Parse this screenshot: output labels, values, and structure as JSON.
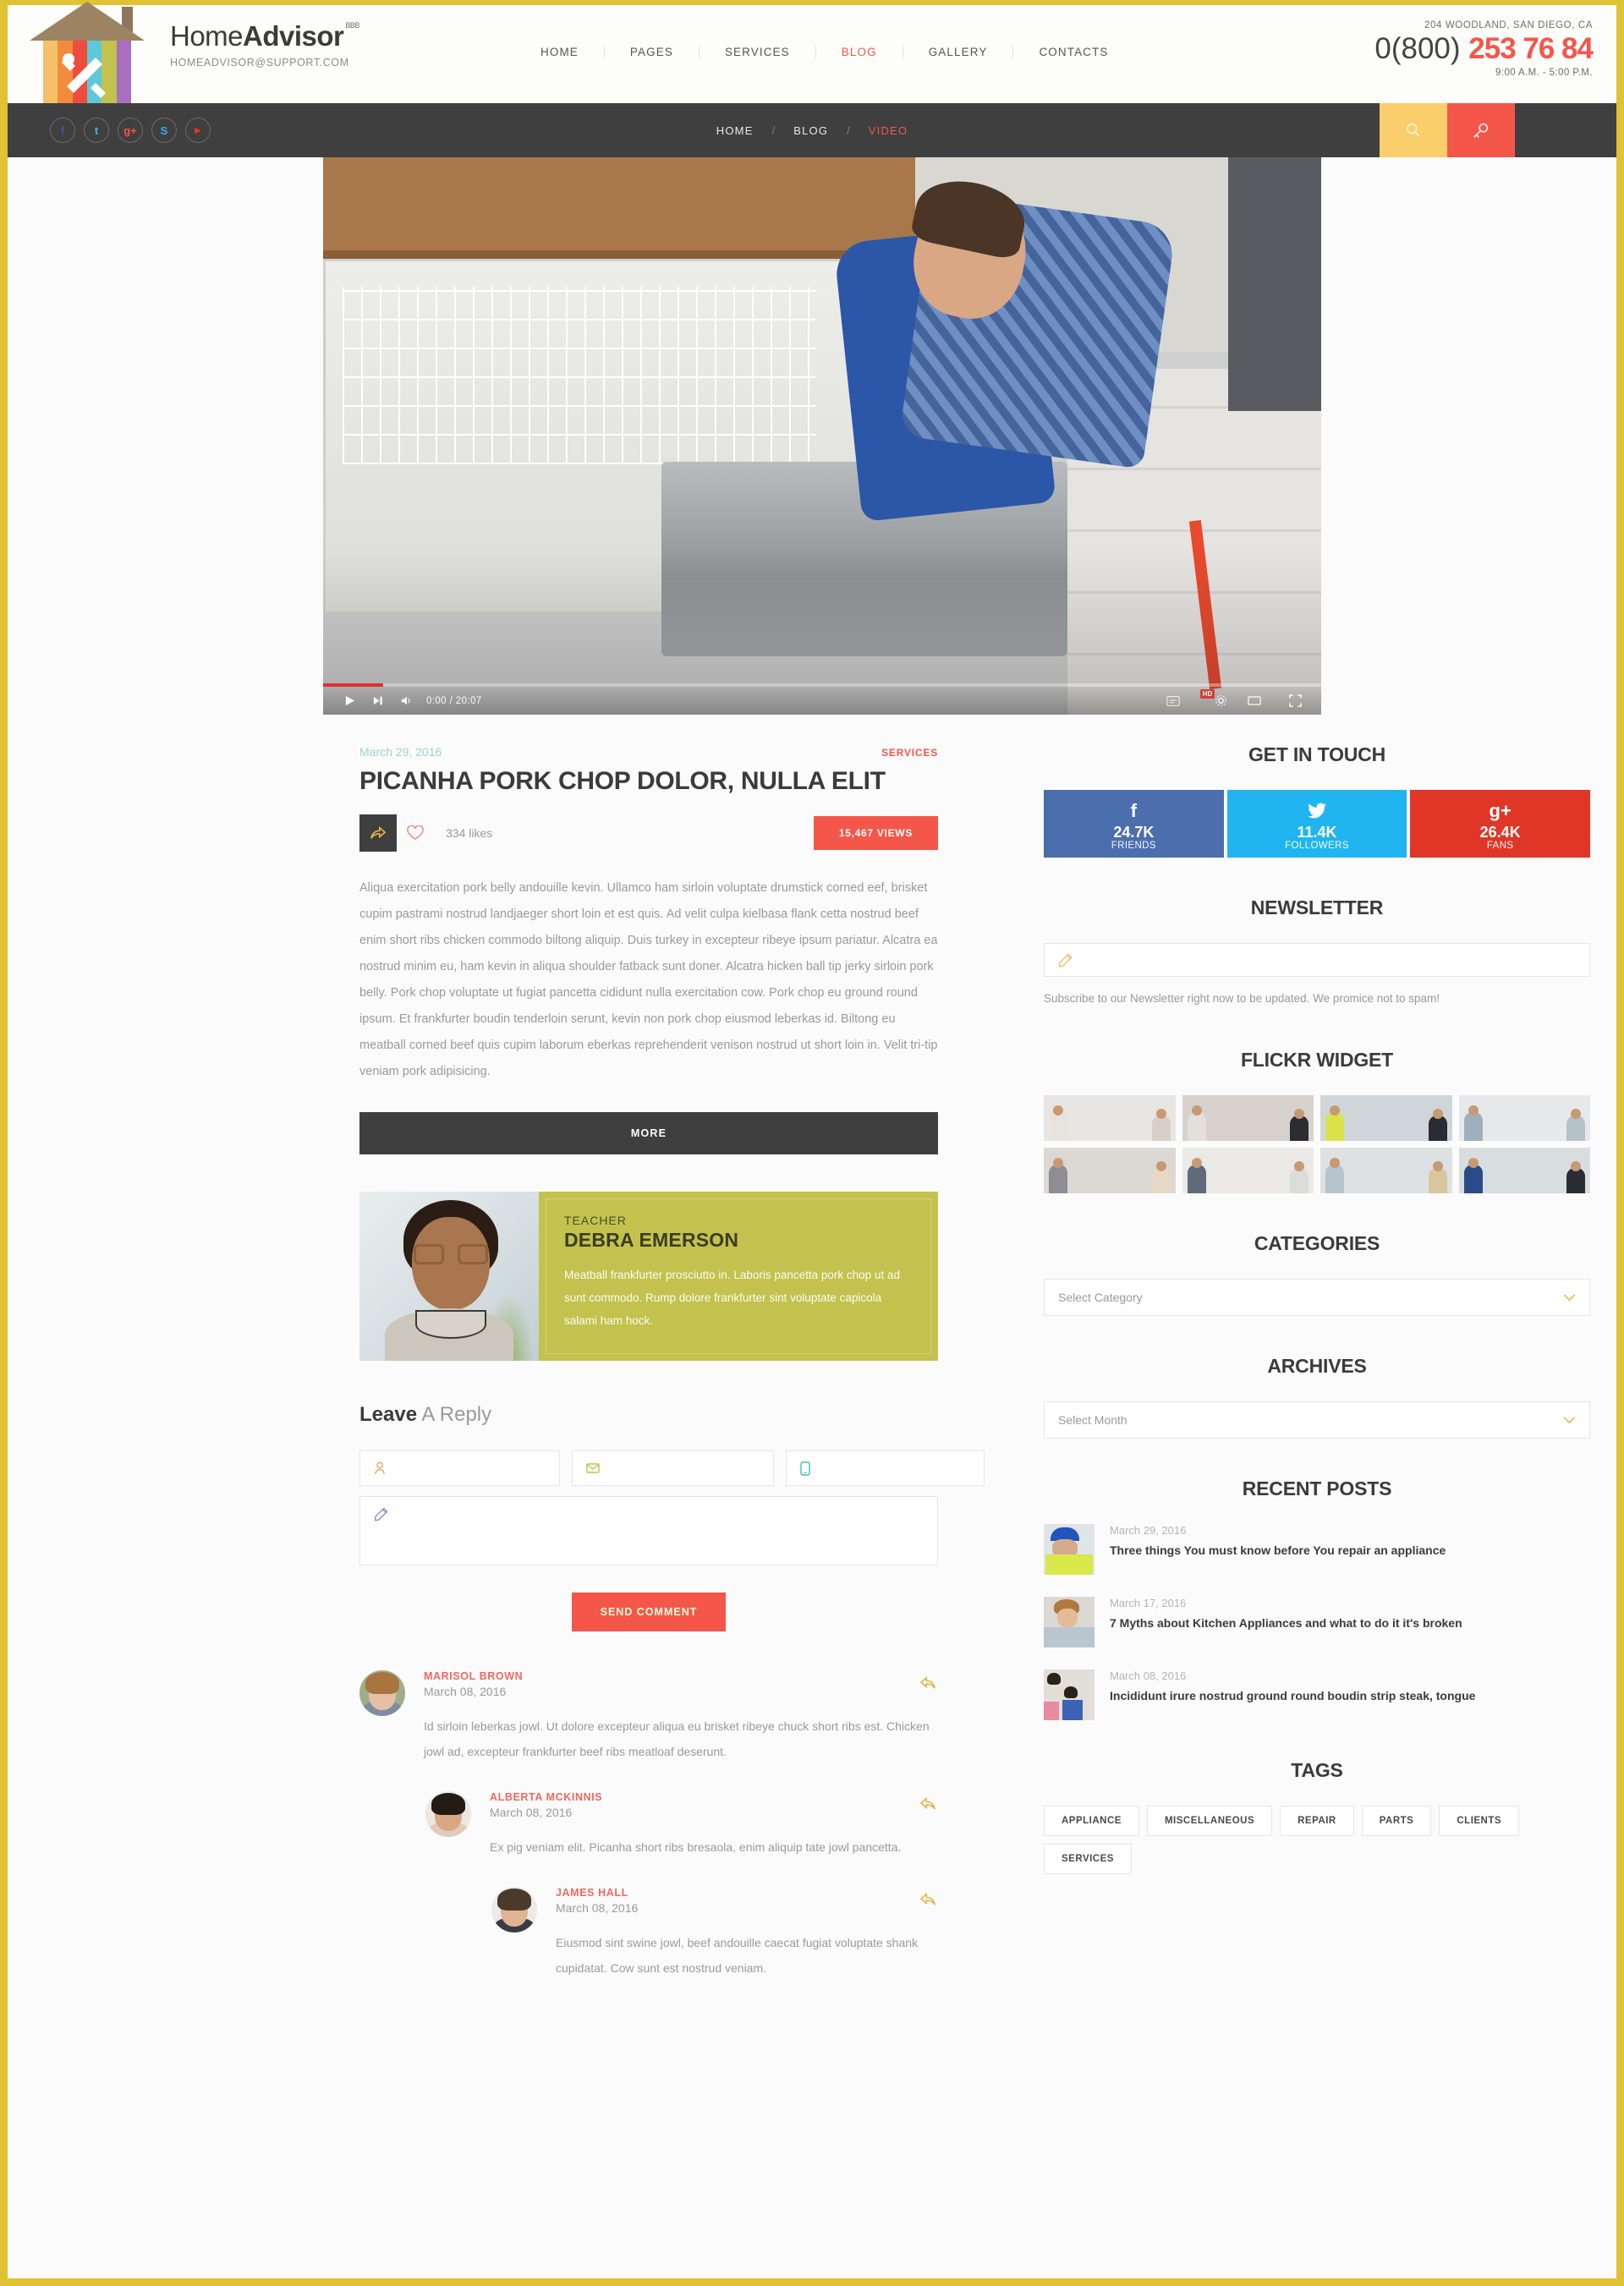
{
  "brand": {
    "name_light": "Home",
    "name_bold": "Advisor",
    "bbb": "BBB",
    "email": "HOMEADVISOR@SUPPORT.COM"
  },
  "topnav": {
    "items": [
      {
        "label": "HOME",
        "active": false
      },
      {
        "label": "PAGES",
        "active": false
      },
      {
        "label": "SERVICES",
        "active": false
      },
      {
        "label": "BLOG",
        "active": true
      },
      {
        "label": "GALLERY",
        "active": false
      },
      {
        "label": "CONTACTS",
        "active": false
      }
    ]
  },
  "contact": {
    "address": "204 WOODLAND, SAN DIEGO, CA",
    "phone_prefix": "0(800)",
    "phone_number": "253 76 84",
    "hours": "9:00 A.M. - 5:00 P.M."
  },
  "darknav": {
    "socials": [
      {
        "name": "facebook",
        "glyph": "f",
        "color": "#3b5998"
      },
      {
        "name": "twitter",
        "glyph": "t",
        "color": "#3ab5e8"
      },
      {
        "name": "google-plus",
        "glyph": "g+",
        "color": "#f5564a"
      },
      {
        "name": "skype",
        "glyph": "S",
        "color": "#2ab0ee"
      },
      {
        "name": "youtube",
        "glyph": "▶",
        "color": "#e8342a"
      }
    ],
    "breadcrumb": [
      {
        "label": "HOME",
        "active": false
      },
      {
        "label": "BLOG",
        "active": false
      },
      {
        "label": "VIDEO",
        "active": true
      }
    ],
    "separator": "/",
    "buttons": [
      {
        "name": "search-button",
        "icon": "search-icon",
        "color": "#fbce6c"
      },
      {
        "name": "login-button",
        "icon": "key-icon",
        "color": "#f5564a"
      }
    ]
  },
  "video": {
    "current_time": "0:00",
    "duration": "20:07",
    "time_display": "0:00 / 20:07",
    "progress_percent": 6,
    "quality_badge": "HD",
    "controls": [
      "play",
      "next",
      "volume",
      "subtitles",
      "settings",
      "theater",
      "fullscreen"
    ]
  },
  "post": {
    "date": "March 29, 2016",
    "category": "SERVICES",
    "title": "PICANHA PORK CHOP DOLOR, NULLA ELIT",
    "likes": "334 likes",
    "views": "15,467 VIEWS",
    "body": "Aliqua exercitation pork belly andouille kevin. Ullamco ham sirloin voluptate drumstick corned eef, brisket cupim pastrami nostrud landjaeger short loin et est quis. Ad velit culpa kielbasa flank cetta nostrud beef enim short ribs chicken commodo biltong aliquip. Duis turkey in excepteur ribeye ipsum pariatur. Alcatra ea nostrud minim eu, ham kevin in aliqua shoulder fatback sunt doner. Alcatra hicken ball tip jerky sirloin pork belly. Pork chop voluptate ut fugiat pancetta cididunt nulla exercitation cow. Pork chop eu ground round ipsum. Et frankfurter boudin tenderloin serunt, kevin non pork chop eiusmod leberkas id. Biltong eu meatball corned beef quis cupim laborum eberkas reprehenderit venison nostrud ut short loin in. Velit tri-tip veniam pork adipisicing.",
    "more_label": "MORE"
  },
  "author": {
    "role": "TEACHER",
    "name": "DEBRA EMERSON",
    "description": "Meatball frankfurter prosciutto in. Laboris pancetta pork chop ut ad sunt commodo. Rump dolore frankfurter sint voluptate capicola salami ham hock."
  },
  "reply": {
    "title_bold": "Leave",
    "title_light": " A Reply",
    "fields": [
      {
        "name": "name-field",
        "icon": "user-icon",
        "icon_color": "#e0a85c",
        "placeholder": ""
      },
      {
        "name": "email-field",
        "icon": "envelope-icon",
        "icon_color": "#c3c24e",
        "placeholder": ""
      },
      {
        "name": "phone-field",
        "icon": "phone-icon",
        "icon_color": "#3ec0c4",
        "placeholder": ""
      }
    ],
    "message": {
      "name": "message-field",
      "icon": "pencil-icon",
      "icon_color": "#9b7fbf",
      "placeholder": ""
    },
    "send_label": "SEND COMMENT"
  },
  "comments": [
    {
      "author": "MARISOL BROWN",
      "date": "March 08, 2016",
      "text": "Id sirloin leberkas jowl. Ut dolore excepteur aliqua eu brisket ribeye chuck short ribs est. Chicken jowl ad, excepteur frankfurter beef ribs meatloaf deserunt.",
      "level": 0,
      "avatar_hair": "#a8743f",
      "avatar_face": "#e6c0a5",
      "avatar_body": "#7d8ea0"
    },
    {
      "author": "ALBERTA MCKINNIS",
      "date": "March 08, 2016",
      "text": "Ex pig veniam elit. Picanha short ribs bresaola, enim aliquip tate jowl pancetta.",
      "level": 1,
      "avatar_hair": "#231b15",
      "avatar_face": "#d8a883",
      "avatar_body": "#e2cbbb"
    },
    {
      "author": "JAMES HALL",
      "date": "March 08, 2016",
      "text": "Eiusmod sint swine jowl, beef andouille caecat fugiat voluptate shank cupidatat. Cow sunt est nostrud veniam.",
      "level": 2,
      "avatar_hair": "#4b3career",
      "avatar_face": "#e0b493",
      "avatar_body": "#3b3b42"
    }
  ],
  "sidebar": {
    "get_in_touch": {
      "title": "GET IN TOUCH",
      "cards": [
        {
          "network": "facebook",
          "glyph": "f",
          "count": "24.7K",
          "label": "FRIENDS",
          "color": "#4b6ead"
        },
        {
          "network": "twitter",
          "glyph": "🐦",
          "count": "11.4K",
          "label": "FOLLOWERS",
          "color": "#20b4f0"
        },
        {
          "network": "google-plus",
          "glyph": "g+",
          "count": "26.4K",
          "label": "FANS",
          "color": "#e03627"
        }
      ]
    },
    "newsletter": {
      "title": "NEWSLETTER",
      "placeholder": "",
      "note": "Subscribe to our Newsletter right now to be updated. We promice not to spam!"
    },
    "flickr": {
      "title": "FLICKR WIDGET",
      "photos": [
        {
          "bg": "#e7e6e3",
          "a": "#e8e4dd",
          "b": "#d9cfc6"
        },
        {
          "bg": "#d7d2cd",
          "a": "#e3e0dc",
          "b": "#2c2c32"
        },
        {
          "bg": "#cfd6da",
          "a": "#d9e24a",
          "b": "#2b2b33"
        },
        {
          "bg": "#e6e9ea",
          "a": "#9fb0bd",
          "b": "#b6c2ca"
        },
        {
          "bg": "#dcd8d3",
          "a": "#8d8d93",
          "b": "#e9d8c3"
        },
        {
          "bg": "#ebe9e5",
          "a": "#5f6b78",
          "b": "#dcdcd8"
        },
        {
          "bg": "#dde1e3",
          "a": "#b6c4cd",
          "b": "#d8c79d"
        },
        {
          "bg": "#d8dde0",
          "a": "#2b4a88",
          "b": "#2b2b33"
        }
      ]
    },
    "categories": {
      "title": "CATEGORIES",
      "selected": "Select Category"
    },
    "archives": {
      "title": "ARCHIVES",
      "selected": "Select Month"
    },
    "recent_posts": {
      "title": "RECENT POSTS",
      "items": [
        {
          "date": "March 29, 2016",
          "title": "Three things You must know before You repair an appliance",
          "thumb": "#dfe4e7"
        },
        {
          "date": "March 17, 2016",
          "title": "7 Myths about Kitchen Appliances and what to do it it's broken",
          "thumb": "#dcd9d4"
        },
        {
          "date": "March 08, 2016",
          "title": "Incididunt irure nostrud ground round boudin strip steak, tongue",
          "thumb": "#e2ded9"
        }
      ]
    },
    "tags": {
      "title": "TAGS",
      "items": [
        "APPLIANCE",
        "MISCELLANEOUS",
        "REPAIR",
        "PARTS",
        "CLIENTS",
        "SERVICES"
      ]
    }
  },
  "colors": {
    "accent_red": "#f5564a",
    "accent_yellow": "#fbce6c",
    "border_gold": "#e0c233",
    "dark": "#3f3f3f",
    "olive": "#c3c24e"
  }
}
